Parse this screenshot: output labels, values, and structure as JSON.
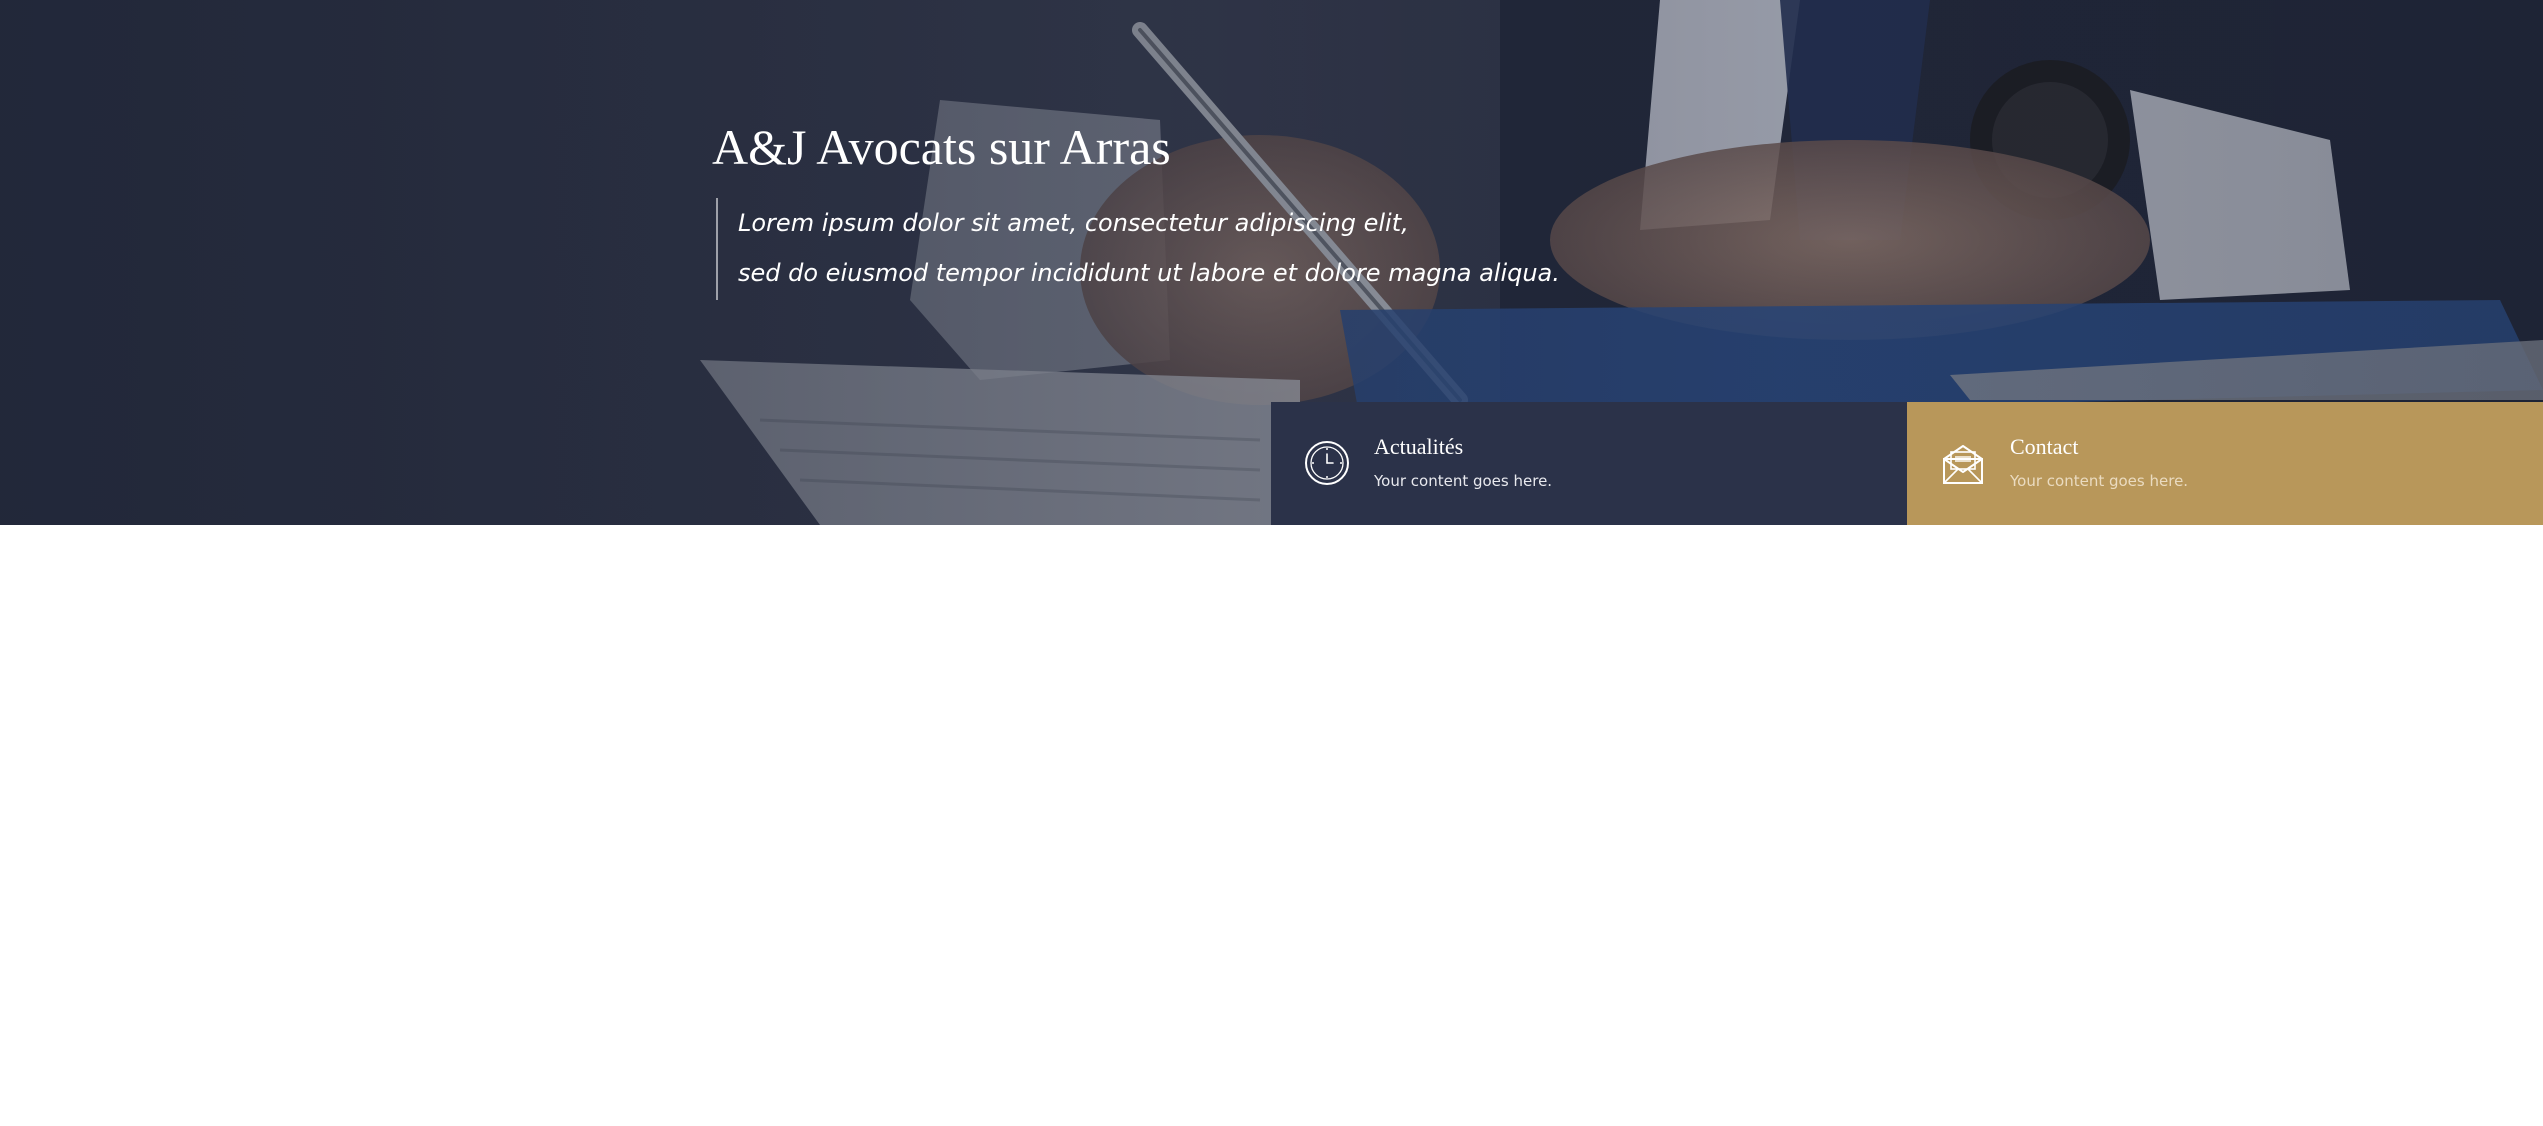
{
  "hero": {
    "title": "A&J Avocats sur Arras",
    "quote_line1": "Lorem ipsum dolor sit amet, consectetur adipiscing elit,",
    "quote_line2": "sed do eiusmod tempor incididunt ut labore et dolore magna aliqua."
  },
  "info_boxes": [
    {
      "title": "Actualités",
      "text": "Your content goes here.",
      "icon": "clock-icon",
      "color": "#2b3249"
    },
    {
      "title": "Contact",
      "text": "Your content goes here.",
      "icon": "open-envelope-icon",
      "color": "#b8975a"
    }
  ],
  "colors": {
    "navy": "#2b3249",
    "gold": "#b8975a",
    "white": "#ffffff"
  }
}
